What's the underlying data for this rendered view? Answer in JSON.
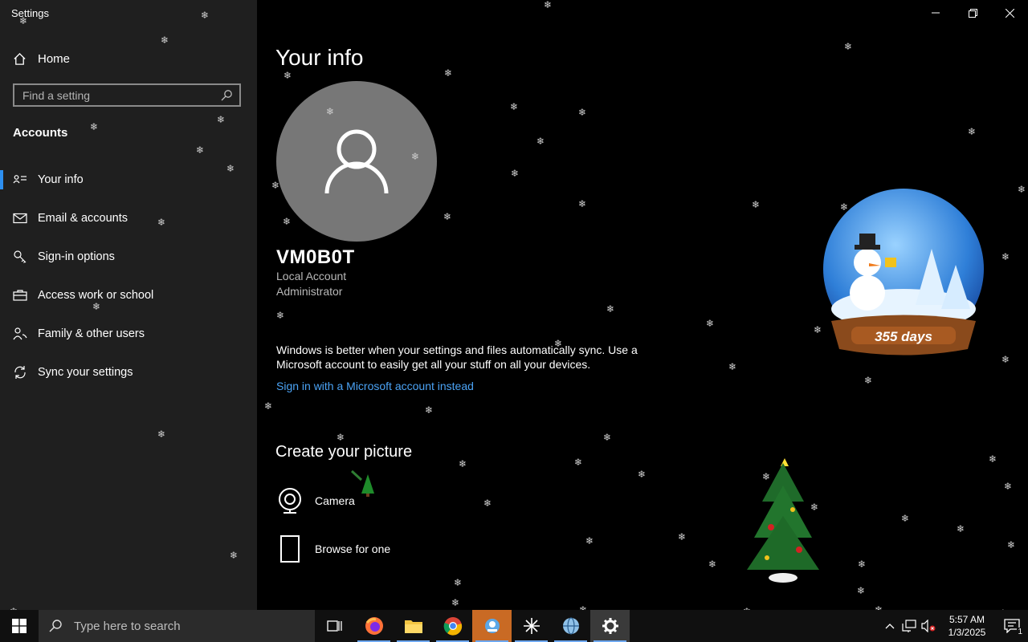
{
  "window": {
    "title": "Settings"
  },
  "sidebar": {
    "home_label": "Home",
    "search_placeholder": "Find a setting",
    "section_title": "Accounts",
    "items": [
      {
        "label": "Your info",
        "icon": "person-card-icon",
        "active": true
      },
      {
        "label": "Email & accounts",
        "icon": "mail-icon",
        "active": false
      },
      {
        "label": "Sign-in options",
        "icon": "key-icon",
        "active": false
      },
      {
        "label": "Access work or school",
        "icon": "briefcase-icon",
        "active": false
      },
      {
        "label": "Family & other users",
        "icon": "people-icon",
        "active": false
      },
      {
        "label": "Sync your settings",
        "icon": "sync-icon",
        "active": false
      }
    ]
  },
  "main": {
    "page_title": "Your info",
    "user": {
      "name": "VM0B0T",
      "account_type": "Local Account",
      "role": "Administrator"
    },
    "sync_message": "Windows is better when your settings and files automatically sync. Use a Microsoft account to easily get all your stuff on all your devices.",
    "sign_in_link": "Sign in with a Microsoft account instead",
    "create_picture": {
      "title": "Create your picture",
      "options": [
        {
          "label": "Camera",
          "icon": "webcam-icon"
        },
        {
          "label": "Browse for one",
          "icon": "document-icon"
        }
      ]
    }
  },
  "decorations": {
    "snow_globe_text": "355 days"
  },
  "taskbar": {
    "search_placeholder": "Type here to search",
    "apps": [
      "task-view-icon",
      "firefox-icon",
      "file-explorer-icon",
      "chrome-icon",
      "snow-app-icon",
      "asterisk-app-icon",
      "globe-app-icon",
      "settings-gear-icon"
    ],
    "clock_time": "5:57 AM",
    "clock_date": "1/3/2025",
    "notification_count": "1"
  },
  "colors": {
    "sidebar_bg": "#1f1f1f",
    "main_bg": "#000000",
    "accent": "#2d8ff0",
    "link": "#4ba3f5",
    "taskbar_bg": "#101010"
  }
}
